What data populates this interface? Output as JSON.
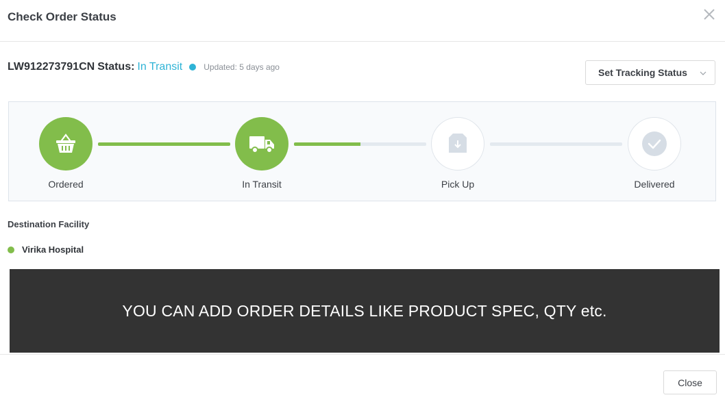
{
  "dialog": {
    "title": "Check Order Status",
    "close_icon": "close-icon"
  },
  "order": {
    "id": "LW912273791CN",
    "status_label": "Status:",
    "status_value": "In Transit",
    "updated": "Updated: 5 days ago",
    "status_color": "#2eb3d6"
  },
  "tracking_button": {
    "label": "Set Tracking Status",
    "icon": "chevron-down-icon"
  },
  "progress": {
    "accent_color": "#82bd4b",
    "steps": [
      {
        "label": "Ordered",
        "icon": "basket-icon",
        "state": "done"
      },
      {
        "label": "In Transit",
        "icon": "truck-icon",
        "state": "done"
      },
      {
        "label": "Pick Up",
        "icon": "box-icon",
        "state": "pending"
      },
      {
        "label": "Delivered",
        "icon": "check-icon",
        "state": "pending"
      }
    ],
    "segments_filled": [
      1.0,
      0.5,
      0.0
    ]
  },
  "destination": {
    "title": "Destination Facility",
    "item": "Virika Hospital"
  },
  "banner": {
    "text": "YOU CAN ADD ORDER DETAILS LIKE PRODUCT SPEC, QTY etc."
  },
  "footer": {
    "close_label": "Close"
  }
}
